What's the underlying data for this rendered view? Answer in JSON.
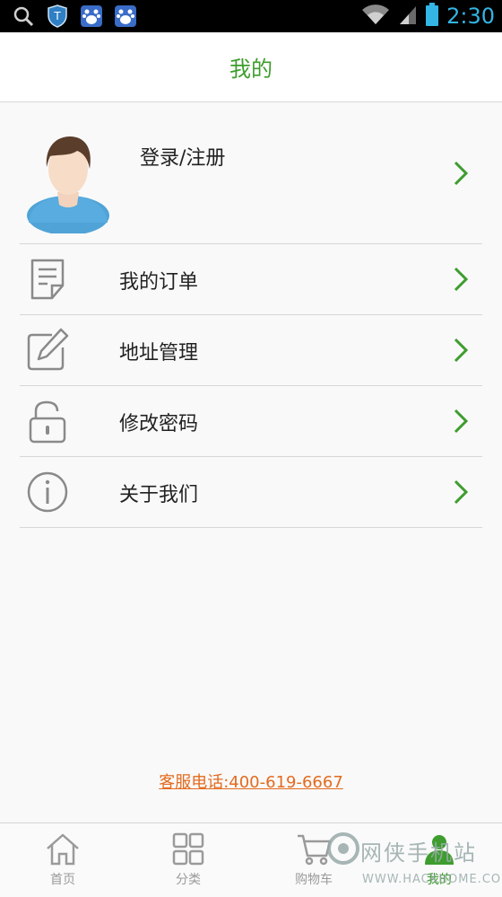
{
  "status_bar": {
    "time": "2:30",
    "left_icons": [
      "search-icon",
      "shield-icon",
      "baidu-paw-icon",
      "baidu-paw-icon"
    ],
    "right_icons": [
      "wifi-icon",
      "signal-icon",
      "battery-icon"
    ]
  },
  "header": {
    "title": "我的"
  },
  "profile": {
    "login_label": "登录/注册"
  },
  "menu": {
    "items": [
      {
        "label": "我的订单",
        "icon": "document-icon"
      },
      {
        "label": "地址管理",
        "icon": "edit-icon"
      },
      {
        "label": "修改密码",
        "icon": "unlock-icon"
      },
      {
        "label": "关于我们",
        "icon": "info-icon"
      }
    ]
  },
  "hotline": {
    "text": "客服电话:400-619-6667"
  },
  "bottom_nav": {
    "tabs": [
      {
        "label": "首页",
        "icon": "home-icon"
      },
      {
        "label": "分类",
        "icon": "grid-icon"
      },
      {
        "label": "购物车",
        "icon": "cart-icon"
      },
      {
        "label": "我的",
        "icon": "user-icon",
        "active": true
      }
    ]
  },
  "watermark": {
    "text": "网侠手机站",
    "sub": "WWW.HACKHOME.COM"
  },
  "colors": {
    "accent": "#3e9d2e",
    "hotline": "#e36b1f",
    "status_time": "#33b5e5"
  }
}
